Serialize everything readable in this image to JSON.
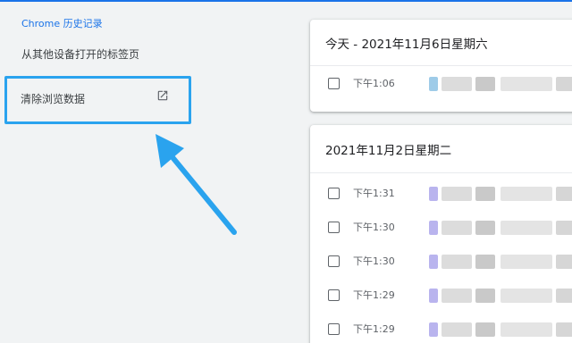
{
  "sidebar": {
    "title": "Chrome 历史记录",
    "other_devices_link": "从其他设备打开的标签页",
    "clear_data_label": "清除浏览数据"
  },
  "groups": [
    {
      "date": "今天 - 2021年11月6日星期六",
      "entries": [
        {
          "time": "下午1:06"
        }
      ]
    },
    {
      "date": "2021年11月2日星期二",
      "entries": [
        {
          "time": "下午1:31"
        },
        {
          "time": "下午1:30"
        },
        {
          "time": "下午1:30"
        },
        {
          "time": "下午1:29"
        },
        {
          "time": "下午1:29"
        }
      ]
    }
  ],
  "colors": {
    "accent": "#1a73e8",
    "highlight_box": "#2aa3ee",
    "background": "#f1f3f4"
  }
}
